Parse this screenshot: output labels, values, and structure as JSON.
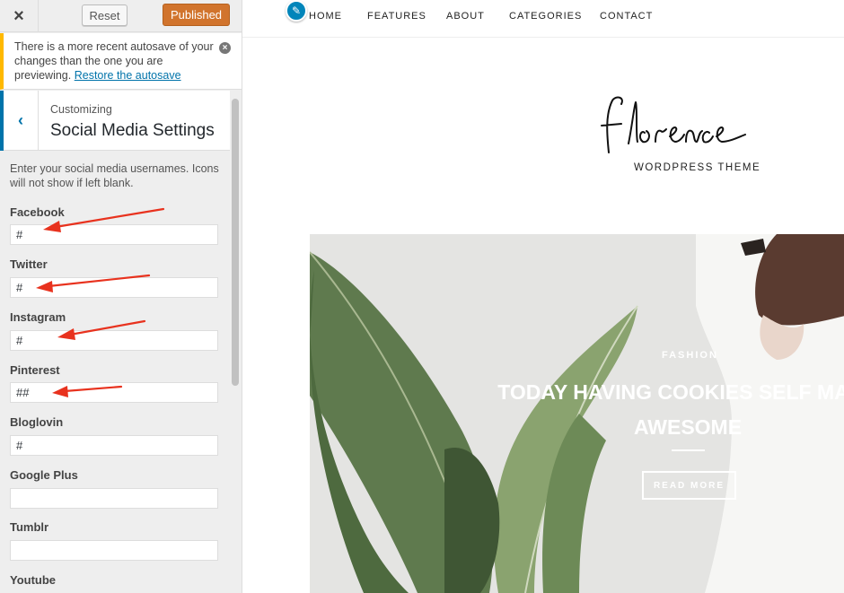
{
  "topbar": {
    "close_icon": "×",
    "reset_label": "Reset",
    "publish_label": "Published"
  },
  "notice": {
    "text": "There is a more recent autosave of your changes than the one you are previewing.",
    "link": "Restore the autosave",
    "dismiss_icon": "×"
  },
  "section": {
    "back_icon": "‹",
    "subtitle": "Customizing",
    "title": "Social Media Settings",
    "description": "Enter your social media usernames. Icons will not show if left blank."
  },
  "fields": [
    {
      "label": "Facebook",
      "value": "#"
    },
    {
      "label": "Twitter",
      "value": "#"
    },
    {
      "label": "Instagram",
      "value": "#"
    },
    {
      "label": "Pinterest",
      "value": "##"
    },
    {
      "label": "Bloglovin",
      "value": "#"
    },
    {
      "label": "Google Plus",
      "value": ""
    },
    {
      "label": "Tumblr",
      "value": ""
    },
    {
      "label": "Youtube",
      "value": ""
    }
  ],
  "nav": {
    "items": [
      "HOME",
      "FEATURES",
      "ABOUT",
      "CATEGORIES",
      "CONTACT"
    ],
    "edit_icon": "✎"
  },
  "logo": {
    "script": "Florence",
    "subtitle": "WORDPRESS THEME"
  },
  "hero": {
    "category": "FASHION",
    "title_line1": "TODAY HAVING COOKIES SELF MADE",
    "title_line2": "AWESOME",
    "button": "READ MORE"
  },
  "colors": {
    "publish": "#d1742d",
    "accent": "#0073aa",
    "notice": "#ffb900",
    "annotation_arrow": "#e8321e"
  }
}
